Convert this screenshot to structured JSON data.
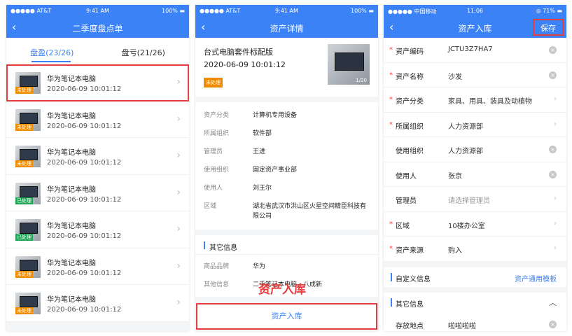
{
  "panel1": {
    "status": {
      "carrier": "●●●●● AT&T",
      "time": "9:41 AM",
      "battery": "100% ▬"
    },
    "back_icon": "chevron-left-icon",
    "title": "二季度盘点单",
    "tabs": [
      {
        "label": "盘盈(23/26)"
      },
      {
        "label": "盘亏(21/26)"
      }
    ],
    "items": [
      {
        "name": "华为笔记本电脑",
        "time": "2020-06-09 10:01:12",
        "status": "未处理"
      },
      {
        "name": "华为笔记本电脑",
        "time": "2020-06-09 10:01:12",
        "status": "未处理"
      },
      {
        "name": "华为笔记本电脑",
        "time": "2020-06-09 10:01:12",
        "status": "未处理"
      },
      {
        "name": "华为笔记本电脑",
        "time": "2020-06-09 10:01:12",
        "status": "已处理"
      },
      {
        "name": "华为笔记本电脑",
        "time": "2020-06-09 10:01:12",
        "status": "已处理"
      },
      {
        "name": "华为笔记本电脑",
        "time": "2020-06-09 10:01:12",
        "status": "未处理"
      },
      {
        "name": "华为笔记本电脑",
        "time": "2020-06-09 10:01:12",
        "status": "未处理"
      }
    ]
  },
  "panel2": {
    "status": {
      "carrier": "●●●●● AT&T",
      "time": "9:41 AM",
      "battery": "100% ▬"
    },
    "title": "资产详情",
    "asset_title": "台式电脑套件标配版",
    "asset_time": "2020-06-09 10:01:12",
    "status_badge": "未处理",
    "image_count": "1/20",
    "details": [
      {
        "label": "资产分类",
        "value": "计算机专用设备"
      },
      {
        "label": "所属组织",
        "value": "软件部"
      },
      {
        "label": "管理员",
        "value": "王进"
      },
      {
        "label": "使用组织",
        "value": "固定资产事业部"
      },
      {
        "label": "使用人",
        "value": "刘王尔"
      },
      {
        "label": "区域",
        "value": "湖北省武汉市洪山区火星空间精臣科技有限公司"
      }
    ],
    "other_title": "其它信息",
    "other": [
      {
        "label": "商品品牌",
        "value": "华为"
      },
      {
        "label": "其他信息",
        "value": "二手笔记本电脑，八成新"
      }
    ],
    "overlay_caption": "资产入库",
    "bottom_button": "资产入库"
  },
  "panel3": {
    "status": {
      "carrier": "●●●●● 中国移动",
      "time": "11:06",
      "battery": "◎ 71% ▬"
    },
    "title": "资产入库",
    "save_label": "保存",
    "fields": [
      {
        "label": "资产编码",
        "value": "JCTU3Z7HA7",
        "required": true,
        "icon": "clear-icon"
      },
      {
        "label": "资产名称",
        "value": "沙发",
        "required": true,
        "icon": "clear-icon"
      },
      {
        "label": "资产分类",
        "value": "家具、用具、装具及动植物",
        "required": true,
        "icon": "chevron-right-icon"
      },
      {
        "label": "所属组织",
        "value": "人力资源部",
        "required": true,
        "icon": "chevron-right-icon"
      },
      {
        "label": "使用组织",
        "value": "人力资源部",
        "required": false,
        "icon": "clear-icon"
      },
      {
        "label": "使用人",
        "value": "张京",
        "required": false,
        "icon": "clear-icon"
      },
      {
        "label": "管理员",
        "value": "请选择管理员",
        "required": false,
        "icon": "chevron-right-icon",
        "placeholder": true
      },
      {
        "label": "区域",
        "value": "10楼办公室",
        "required": true,
        "icon": "chevron-right-icon"
      },
      {
        "label": "资产来源",
        "value": "购入",
        "required": true,
        "icon": "chevron-right-icon"
      }
    ],
    "custom_title": "自定义信息",
    "custom_link": "资产通用模板",
    "other_title": "其它信息",
    "storage_label": "存放地点",
    "storage_value": "啦啦啦啦"
  },
  "colors": {
    "primary": "#3b82f6",
    "highlight": "#e53e3e",
    "pending": "#f08c00",
    "done": "#22a559"
  }
}
